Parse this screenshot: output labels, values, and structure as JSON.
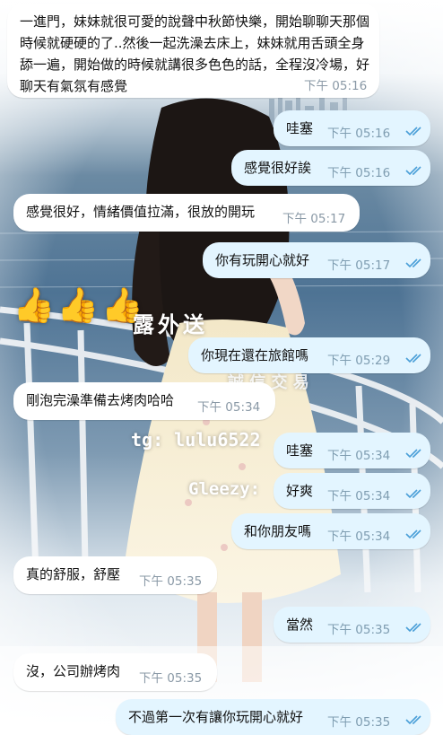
{
  "background": {
    "emojis": [
      "👍",
      "👍",
      "👍"
    ],
    "brand_text": "露外送",
    "brand_sub": "誠 信 交 易",
    "telegram_text": "tg: lulu6522",
    "gleezy_text": "Gleezy:"
  },
  "messages": [
    {
      "dir": "in",
      "text": "一進門，妹妹就很可愛的說聲中秋節快樂，開始聊聊天那個時候就硬硬的了..然後一起洗澡去床上，妹妹就用舌頭全身舔一遍，開始做的時候就講很多色色的話，全程沒冷場，好聊天有氣氛有感覺",
      "time": "下午 05:16"
    },
    {
      "dir": "out",
      "text": "哇塞",
      "time": "下午 05:16"
    },
    {
      "dir": "out",
      "text": "感覺很好誒",
      "time": "下午 05:16"
    },
    {
      "dir": "in",
      "text": "感覺很好，情緒價值拉滿，很放的開玩",
      "time": "下午 05:17"
    },
    {
      "dir": "out",
      "text": "你有玩開心就好",
      "time": "下午 05:17"
    },
    {
      "dir": "out",
      "text": "你現在還在旅館嗎",
      "time": "下午 05:29"
    },
    {
      "dir": "in",
      "text": "剛泡完澡準備去烤肉哈哈",
      "time": "下午 05:34"
    },
    {
      "dir": "out",
      "text": "哇塞",
      "time": "下午 05:34"
    },
    {
      "dir": "out",
      "text": "好爽",
      "time": "下午 05:34"
    },
    {
      "dir": "out",
      "text": "和你朋友嗎",
      "time": "下午 05:34"
    },
    {
      "dir": "in",
      "text": "真的舒服，舒壓",
      "time": "下午 05:35"
    },
    {
      "dir": "out",
      "text": "當然",
      "time": "下午 05:35"
    },
    {
      "dir": "in",
      "text": "沒，公司辦烤肉",
      "time": "下午 05:35"
    },
    {
      "dir": "out",
      "text": "不過第一次有讓你玩開心就好",
      "time": "下午 05:35"
    }
  ],
  "colors": {
    "incoming_bubble": "#ffffff",
    "outgoing_bubble": "#e3f5ff",
    "read_tick": "#4a9fd8",
    "timestamp": "#8a99a6"
  }
}
